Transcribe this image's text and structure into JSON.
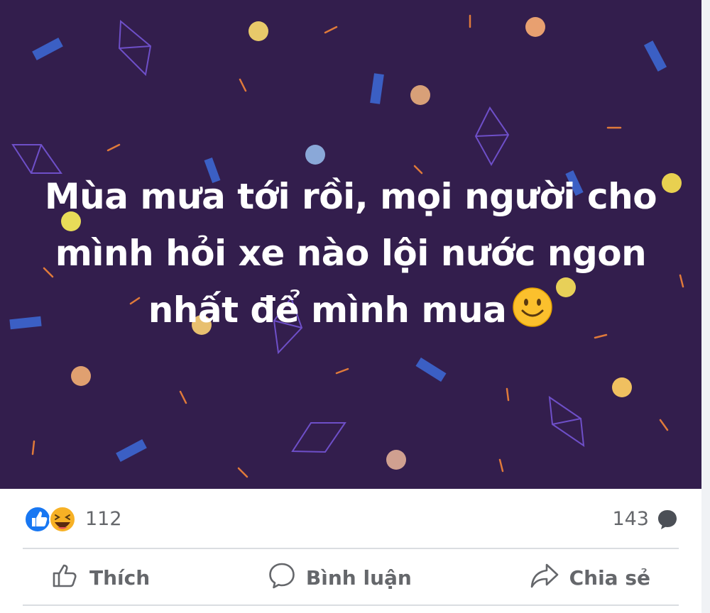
{
  "post": {
    "text_lines": [
      "Mùa mưa tới rồi, mọi người cho",
      "mình hỏi xe nào lội nước ngon",
      "nhất để mình mua"
    ],
    "background_color": "#331e4d",
    "text_emoji": "slightly-smiling-face"
  },
  "reactions": {
    "icons": [
      "like-reaction-icon",
      "haha-reaction-icon"
    ],
    "count": "112",
    "like_color": "#1877f2",
    "haha_color": "#f7b125"
  },
  "comments": {
    "count": "143",
    "icon": "comment-bubble-icon"
  },
  "actions": {
    "like_label": "Thích",
    "comment_label": "Bình luận",
    "share_label": "Chia sẻ"
  },
  "colors": {
    "action_text": "#65676b",
    "divider": "#dadde1"
  }
}
